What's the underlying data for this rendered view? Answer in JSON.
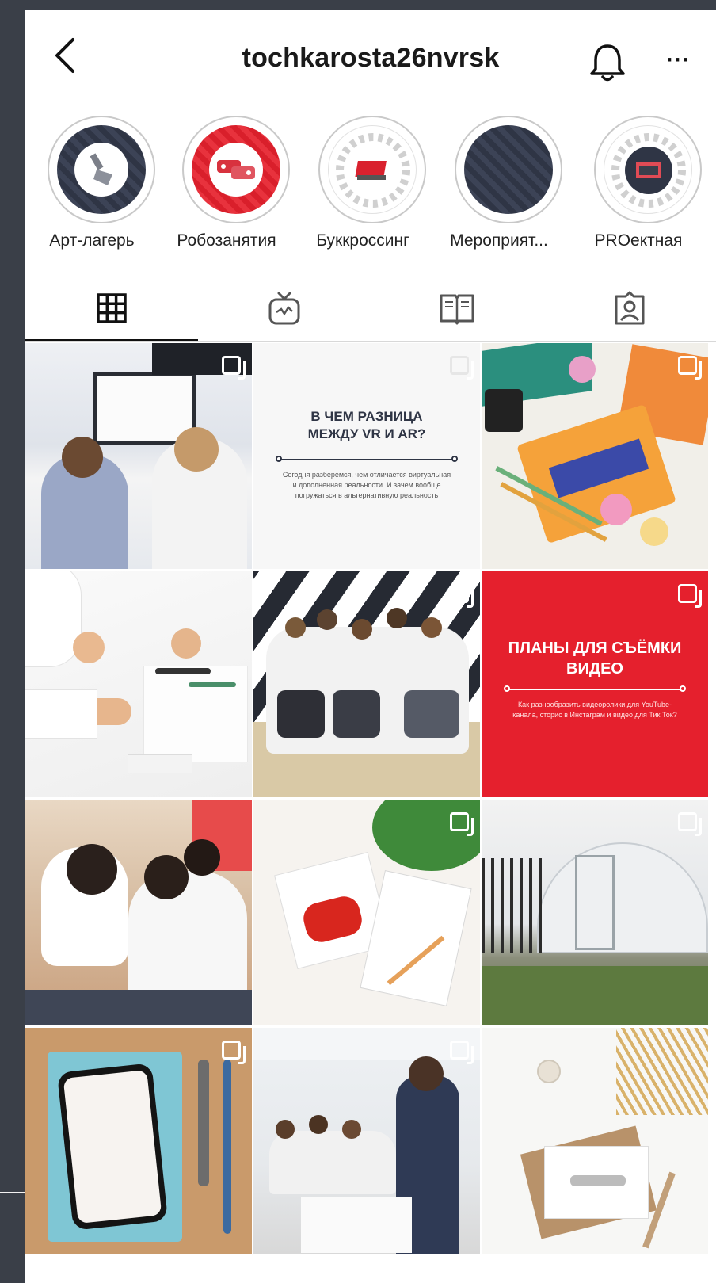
{
  "header": {
    "username": "tochkarosta26nvrsk",
    "more": "···"
  },
  "highlights": [
    {
      "label": "Арт-лагерь",
      "icon": "paintbrush-icon"
    },
    {
      "label": "Робозанятия",
      "icon": "robot-parts-icon"
    },
    {
      "label": "Буккроссинг",
      "icon": "book-icon"
    },
    {
      "label": "Мероприят...",
      "icon": "events-icon"
    },
    {
      "label": "PROектная",
      "icon": "presentation-icon"
    }
  ],
  "tabs": [
    {
      "name": "posts-grid",
      "icon": "grid-icon",
      "active": true
    },
    {
      "name": "igtv",
      "icon": "tv-icon",
      "active": false
    },
    {
      "name": "guides",
      "icon": "guide-book-icon",
      "active": false
    },
    {
      "name": "tagged",
      "icon": "tagged-person-icon",
      "active": false
    }
  ],
  "posts": {
    "vr_ar": {
      "title": "В ЧЕМ РАЗНИЦА МЕЖДУ VR И AR?",
      "text": "Сегодня разберемся, чем отличается виртуальная и дополненная реальности. И зачем вообще погружаться в альтернативную реальность"
    },
    "video_plans": {
      "title": "ПЛАНЫ ДЛЯ СЪЁМКИ ВИДЕО",
      "text": "Как разнообразить видеоролики для YouTube-канала, сторис в Инстаграм и видео для Тик Ток?"
    }
  },
  "colors": {
    "accent_red": "#e5202d",
    "navy": "#2f3545",
    "frame": "#3a3f48"
  }
}
